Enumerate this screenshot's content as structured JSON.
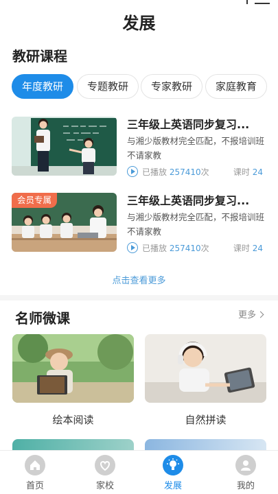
{
  "header": {
    "title": "发展"
  },
  "research": {
    "section_title": "教研课程",
    "tabs": [
      {
        "label": "年度教研",
        "active": true
      },
      {
        "label": "专题教研",
        "active": false
      },
      {
        "label": "专家教研",
        "active": false
      },
      {
        "label": "家庭教育",
        "active": false
      }
    ],
    "courses": [
      {
        "title": "三年级上英语同步复习...",
        "desc": "与湘少版教材完全匹配，不报培训班不请家教",
        "played_prefix": "已播放",
        "play_count": "257410",
        "played_suffix": "次",
        "lessons_label": "课时",
        "lessons": "24",
        "badge": ""
      },
      {
        "title": "三年级上英语同步复习...",
        "desc": "与湘少版教材完全匹配，不报培训班不请家教",
        "played_prefix": "已播放",
        "play_count": "257410",
        "played_suffix": "次",
        "lessons_label": "课时",
        "lessons": "24",
        "badge": "会员专属"
      }
    ],
    "more_link": "点击查看更多"
  },
  "teachers": {
    "section_title": "名师微课",
    "more_label": "更多",
    "cards": [
      {
        "label": "绘本阅读"
      },
      {
        "label": "自然拼读"
      }
    ]
  },
  "tabbar": {
    "items": [
      {
        "label": "首页",
        "icon": "home-icon",
        "active": false
      },
      {
        "label": "家校",
        "icon": "heart-icon",
        "active": false
      },
      {
        "label": "发展",
        "icon": "bulb-icon",
        "active": true
      },
      {
        "label": "我的",
        "icon": "user-icon",
        "active": false
      }
    ]
  },
  "colors": {
    "accent": "#1e8ce8",
    "link": "#4a9ad8",
    "badge": "#f06d4b"
  }
}
